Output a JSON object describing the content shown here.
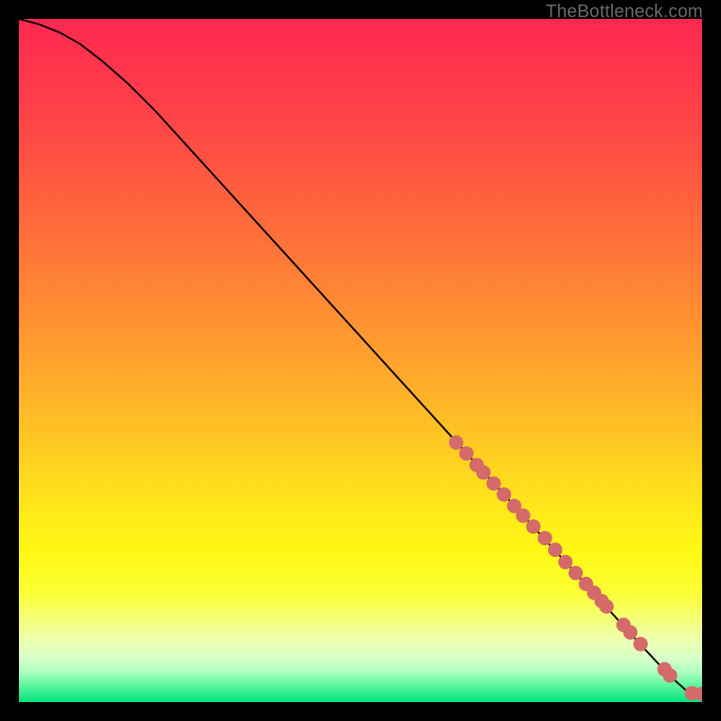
{
  "watermark": "TheBottleneck.com",
  "chart_data": {
    "type": "line",
    "title": "",
    "xlabel": "",
    "ylabel": "",
    "xlim": [
      0,
      100
    ],
    "ylim": [
      0,
      100
    ],
    "grid": false,
    "legend": false,
    "background_gradient": {
      "stops": [
        {
          "offset": 0.0,
          "color": "#ff2850"
        },
        {
          "offset": 0.1,
          "color": "#ff3a4b"
        },
        {
          "offset": 0.2,
          "color": "#ff5043"
        },
        {
          "offset": 0.3,
          "color": "#ff6a3b"
        },
        {
          "offset": 0.4,
          "color": "#ff8634"
        },
        {
          "offset": 0.5,
          "color": "#ffa22d"
        },
        {
          "offset": 0.6,
          "color": "#ffc225"
        },
        {
          "offset": 0.7,
          "color": "#ffe31c"
        },
        {
          "offset": 0.78,
          "color": "#fff814"
        },
        {
          "offset": 0.84,
          "color": "#fbff34"
        },
        {
          "offset": 0.88,
          "color": "#f4ff7a"
        },
        {
          "offset": 0.91,
          "color": "#ecffb0"
        },
        {
          "offset": 0.935,
          "color": "#d9ffc8"
        },
        {
          "offset": 0.955,
          "color": "#b0ffc0"
        },
        {
          "offset": 0.975,
          "color": "#60f7a0"
        },
        {
          "offset": 1.0,
          "color": "#00e47a"
        }
      ]
    },
    "series": [
      {
        "name": "bottleneck-curve",
        "type": "line",
        "color": "#000000",
        "x": [
          0,
          3,
          6,
          9,
          12,
          16,
          20,
          25,
          30,
          35,
          40,
          45,
          50,
          55,
          60,
          65,
          70,
          75,
          80,
          85,
          88,
          91,
          94,
          96,
          98,
          100
        ],
        "y": [
          100,
          99.2,
          98.0,
          96.3,
          94.0,
          90.5,
          86.5,
          81.0,
          75.5,
          70.0,
          64.5,
          59.0,
          53.5,
          48.0,
          42.5,
          37.0,
          31.5,
          26.0,
          20.5,
          15.0,
          11.7,
          8.4,
          5.2,
          3.2,
          1.4,
          1.2
        ]
      },
      {
        "name": "data-points",
        "type": "scatter",
        "color": "#d46a6a",
        "marker_radius": 8,
        "x": [
          64,
          65.5,
          67,
          68,
          69.5,
          71,
          72.5,
          73.8,
          75.3,
          77,
          78.5,
          80,
          81.5,
          83,
          84.2,
          85.3,
          86,
          88.5,
          89.5,
          91,
          94.5,
          95.3,
          98.5,
          100
        ],
        "y": [
          38.0,
          36.4,
          34.7,
          33.6,
          32.0,
          30.4,
          28.7,
          27.3,
          25.7,
          24.0,
          22.3,
          20.5,
          18.9,
          17.3,
          16.0,
          14.8,
          14.0,
          11.3,
          10.2,
          8.5,
          4.8,
          3.9,
          1.3,
          1.2
        ]
      }
    ]
  }
}
